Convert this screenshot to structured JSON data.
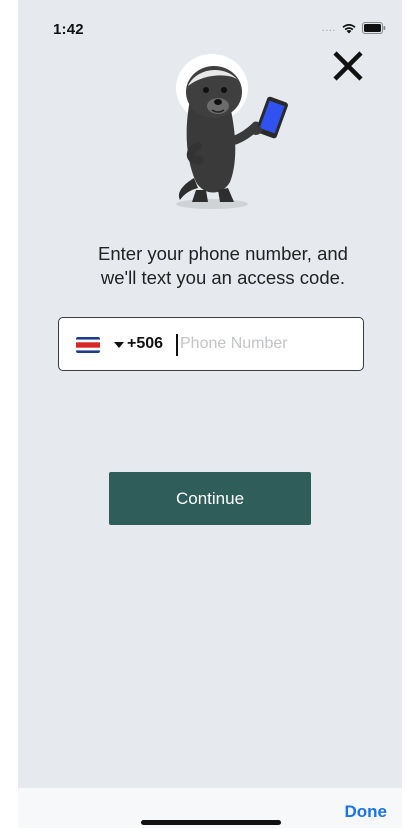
{
  "status_bar": {
    "time": "1:42",
    "signal_dots": "....",
    "wifi_icon": "wifi-icon",
    "battery_icon": "battery-icon"
  },
  "close_icon": "close-icon",
  "mascot_icon": "honey-badger-holding-phone-illustration",
  "prompt": {
    "line1": "Enter your phone number, and",
    "line2": "we'll text you an access code."
  },
  "phone_field": {
    "country_flag": "costa-rica-flag-icon",
    "country_code": "+506",
    "value": "",
    "placeholder": "Phone Number"
  },
  "continue_label": "Continue",
  "keyboard_accessory": {
    "done_label": "Done"
  },
  "colors": {
    "background": "#e6eaee",
    "button": "#2f5d59",
    "done": "#1a73e8"
  }
}
